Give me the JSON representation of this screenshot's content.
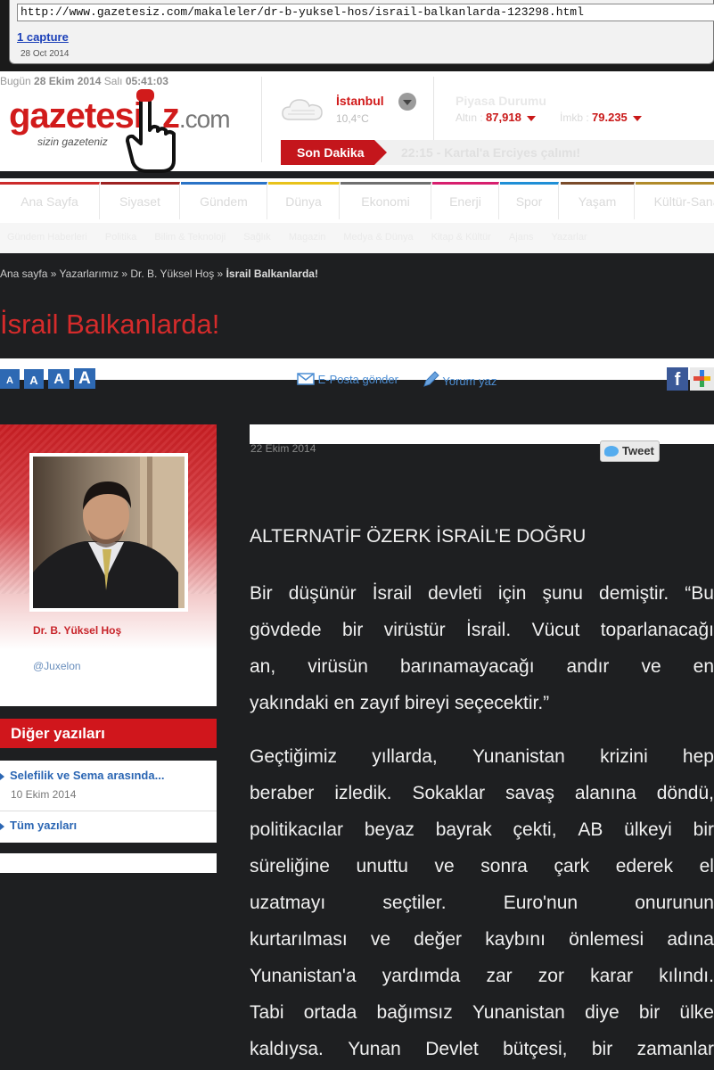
{
  "wayback": {
    "url": "http://www.gazetesiz.com/makaleler/dr-b-yuksel-hos/israil-balkanlarda-123298.html",
    "captures": "1 capture",
    "date": "28 Oct 2014"
  },
  "header": {
    "today_prefix": "Bugün",
    "today_date": "28 Ekim 2014",
    "today_day": "Salı",
    "today_time": "05:41:03",
    "logo_main": "gazetes",
    "logo_i": "i",
    "logo_z": "z",
    "logo_com": ".com",
    "slogan": "sizin gazeteniz",
    "weather": {
      "city": "İstanbul",
      "temp": "10,4°C"
    },
    "market": {
      "title": "Piyasa Durumu",
      "gold_label": "Altın :",
      "gold_value": "87,918",
      "imkb_label": "İmkb :",
      "imkb_value": "79.235"
    },
    "breaking": {
      "label": "Son Dakika",
      "text": "22:15 - Kartal'a Erciyes çalımı!"
    }
  },
  "nav": {
    "items": [
      {
        "label": "Ana Sayfa",
        "color": "#cc2b2b"
      },
      {
        "label": "Siyaset",
        "color": "#9d2222"
      },
      {
        "label": "Gündem",
        "color": "#2a73c6"
      },
      {
        "label": "Dünya",
        "color": "#e8c21a"
      },
      {
        "label": "Ekonomi",
        "color": "#6f6f6f"
      },
      {
        "label": "Enerji",
        "color": "#d71f6e"
      },
      {
        "label": "Spor",
        "color": "#1f8fd6"
      },
      {
        "label": "Yaşam",
        "color": "#7a4b2a"
      },
      {
        "label": "Kültür-Sanat",
        "color": "#b08a2a"
      }
    ],
    "subnav": [
      "Gündem Haberleri",
      "Politika",
      "Bilim & Teknoloji",
      "Sağlık",
      "Magazin",
      "Medya & Dünya",
      "Kitap & Kültür",
      "Ajans",
      "Yazarlar"
    ]
  },
  "breadcrumb": {
    "home": "Ana sayfa",
    "sep": "»",
    "writers": "Yazarlarımız",
    "author": "Dr. B. Yüksel Hoş",
    "current": "İsrail Balkanlarda!"
  },
  "article_title": "İsrail Balkanlarda!",
  "toolbar": {
    "font_sizes": [
      "A",
      "A",
      "A",
      "A"
    ],
    "email": "E-Posta gönder",
    "comment": "Yorum yaz"
  },
  "author": {
    "name": "Dr. B. Yüksel Hoş",
    "twitter": "@Juxelon"
  },
  "other_posts": {
    "heading": "Diğer yazıları",
    "items": [
      {
        "title": "Selefilik ve Sema arasında...",
        "date": "10 Ekim 2014"
      },
      {
        "title": "Tüm yazıları"
      }
    ]
  },
  "article": {
    "date": "22 Ekim 2014",
    "tweet": "Tweet",
    "headline": "ALTERNATİF ÖZERK İSRAİL’E DOĞRU",
    "p1": [
      [
        "Bir",
        "düşünür",
        "İsrail",
        "devleti",
        "için",
        "şunu",
        "demiştir.",
        "“Bu"
      ],
      [
        "gövdede",
        "bir",
        "virüstür",
        "İsrail.",
        "Vücut",
        "toparlanacağı"
      ],
      [
        "an,",
        "virüsün",
        "barınamayacağı",
        "andır",
        "ve",
        "en"
      ],
      [
        "yakındaki en zayıf bireyi seçecektir.”"
      ]
    ],
    "p2": [
      [
        "Geçtiğimiz",
        "yıllarda,",
        "Yunanistan",
        "krizini",
        "hep"
      ],
      [
        "beraber",
        "izledik.",
        "Sokaklar",
        "savaş",
        "alanına",
        "döndü,"
      ],
      [
        "politikacılar",
        "beyaz",
        "bayrak",
        "çekti,",
        "AB",
        "ülkeyi",
        "bir"
      ],
      [
        "süreliğine",
        "unuttu",
        "ve",
        "sonra",
        "çark",
        "ederek",
        "el"
      ],
      [
        "uzatmayı",
        "seçtiler.",
        "Euro'nun",
        "onurunun"
      ],
      [
        "kurtarılması",
        "ve",
        "değer",
        "kaybını",
        "önlemesi",
        "adına"
      ],
      [
        "Yunanistan'a",
        "yardımda",
        "zar",
        "zor",
        "karar",
        "kılındı."
      ],
      [
        "Tabi",
        "ortada",
        "bağımsız",
        "Yunanistan",
        "diye",
        "bir",
        "ülke"
      ],
      [
        "kaldıysa.",
        "Yunan",
        "Devlet",
        "bütçesi,",
        "bir",
        "zamanlar"
      ]
    ]
  }
}
